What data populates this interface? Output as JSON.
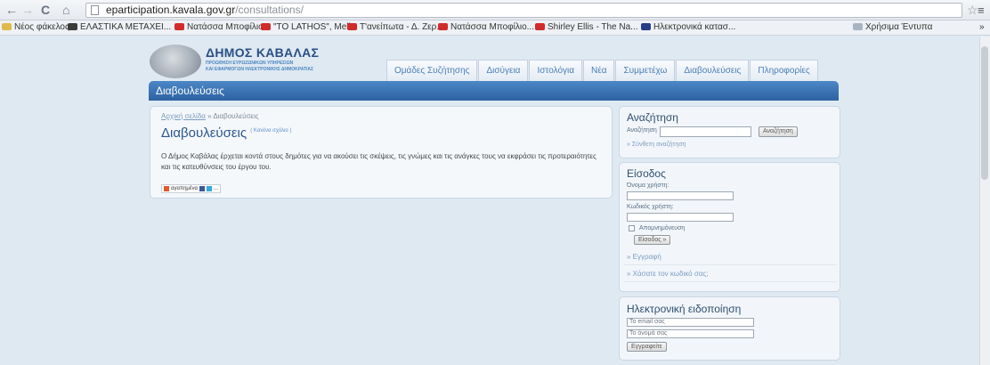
{
  "browser": {
    "url_host": "eparticipation.kavala.gov.gr",
    "url_path": "/consultations/",
    "bookmarks": [
      {
        "label": "Νέος φάκελος",
        "icon": "folder-icon"
      },
      {
        "label": "ΕΛΑΣΤΙΚΑ ΜΕΤΑΧΕΙ...",
        "icon": "bookmark-icon"
      },
      {
        "label": "Νατάσσα Μποφίλιο...",
        "icon": "youtube-icon"
      },
      {
        "label": "\"TO LATHOS\", Meli...",
        "icon": "youtube-icon"
      },
      {
        "label": "Τ'ανείπωτα - Δ. Ζερ...",
        "icon": "youtube-icon"
      },
      {
        "label": "Νατάσσα Μποφίλιο...",
        "icon": "youtube-icon"
      },
      {
        "label": "Shirley Ellis - The Na...",
        "icon": "youtube-icon"
      },
      {
        "label": "Ηλεκτρονικά κατασ...",
        "icon": "n-icon"
      },
      {
        "label": "Χρήσιμα Έντυπα",
        "icon": "bookmark-icon"
      }
    ],
    "overflow": "»"
  },
  "header": {
    "logo_title": "ΔΗΜΟΣ ΚΑΒΑΛΑΣ",
    "logo_subtitle_1": "ΠΡΟΩΘΗΣΗ ΕΥΡΩΖΩΝΙΚΩΝ ΥΠΗΡΕΣΙΩΝ",
    "logo_subtitle_2": "ΚΑΙ ΕΦΑΡΜΟΓΩΝ ΗΛΕΚΤΡΟΝΙΚΗΣ ΔΗΜΟΚΡΑΤΙΑΣ",
    "tabs": [
      "Ομάδες Συζήτησης",
      "Δισύγεια",
      "Ιστολόγια",
      "Νέα",
      "Συμμετέχω",
      "Διαβουλεύσεις",
      "Πληροφορίες"
    ]
  },
  "section_title": "Διαβουλεύσεις",
  "main": {
    "breadcrumb_home": "Αρχική σελίδα",
    "breadcrumb_sep": "»",
    "breadcrumb_current": "Διαβουλεύσεις",
    "heading": "Διαβουλεύσεις",
    "heading_note": "( Κανένα σχόλιο )",
    "description": "Ο Δήμος Καβάλας έρχεται κοντά στους δημότες για να ακούσει τις σκέψεις, τις γνώμες και τις ανάγκες τους να εκφράσει τις προτεραιότητες και τις κατευθύνσεις του έργου του.",
    "share_label": "αγαπημένα",
    "share_more": "..."
  },
  "search": {
    "title": "Αναζήτηση",
    "label": "Αναζήτηση",
    "button": "Αναζήτηση",
    "advanced_link": "» Σύνθετη αναζήτηση"
  },
  "login": {
    "title": "Είσοδος",
    "username_label": "Όνομα χρήστη:",
    "password_label": "Κωδικός χρήστη:",
    "remember_label": "Απομνημόνευση",
    "button": "Είσοδος »",
    "register_link": "» Εγγραφή",
    "forgot_link": "» Χάσατε τον κωδικό σας;"
  },
  "newsletter": {
    "title": "Ηλεκτρονική ειδοποίηση",
    "email_value": "Το email σας",
    "name_value": "Το όνομά σας",
    "button": "Εγγραφείτε"
  }
}
